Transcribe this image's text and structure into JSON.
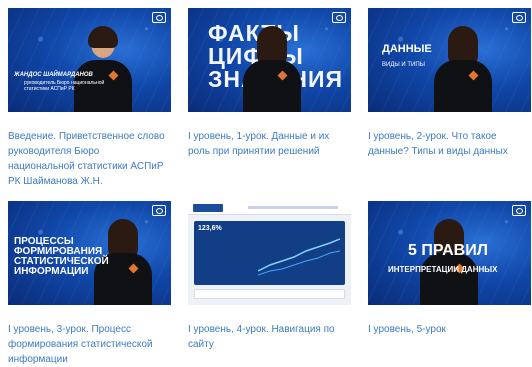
{
  "videos": [
    {
      "caption": "Введение. Приветственное слово руководителя Бюро национальной статистики АСПиР РК Шайманова Ж.Н.",
      "thumb_name": "ЖАНДОС ШАЙМАРДАНОВ",
      "thumb_role": "руководитель Бюро национальной\nстатистики АСПиР РК"
    },
    {
      "caption": "I уровень, 1-урок. Данные и их роль при принятии решений",
      "thumb_title": "ФАКТЫ\nЦИФРЫ\nЗНАЧЕНИЯ"
    },
    {
      "caption": "I уровень, 2-урок. Что такое данные? Типы и виды данных",
      "thumb_title": "ДАННЫЕ",
      "thumb_sub": "ВИДЫ И ТИПЫ"
    },
    {
      "caption": "I уровень, 3-урок. Процесс формирования статистической информации",
      "thumb_title": "ПРОЦЕССЫ\nФОРМИРОВАНИЯ\nСТАТИСТИЧЕСКОЙ\nИНФОРМАЦИИ"
    },
    {
      "caption": "I уровень, 4-урок. Навигация по сайту",
      "thumb_stat": "123,6%"
    },
    {
      "caption": "I уровень, 5-урок",
      "thumb_title": "5 ПРАВИЛ",
      "thumb_sub": "ИНТЕРПРЕТАЦИИ ДАННЫХ"
    }
  ],
  "colors": {
    "link": "#3d7bc2",
    "thumb_blue": "#1047a8"
  },
  "icons": {
    "logo": "bns-logo-icon"
  }
}
